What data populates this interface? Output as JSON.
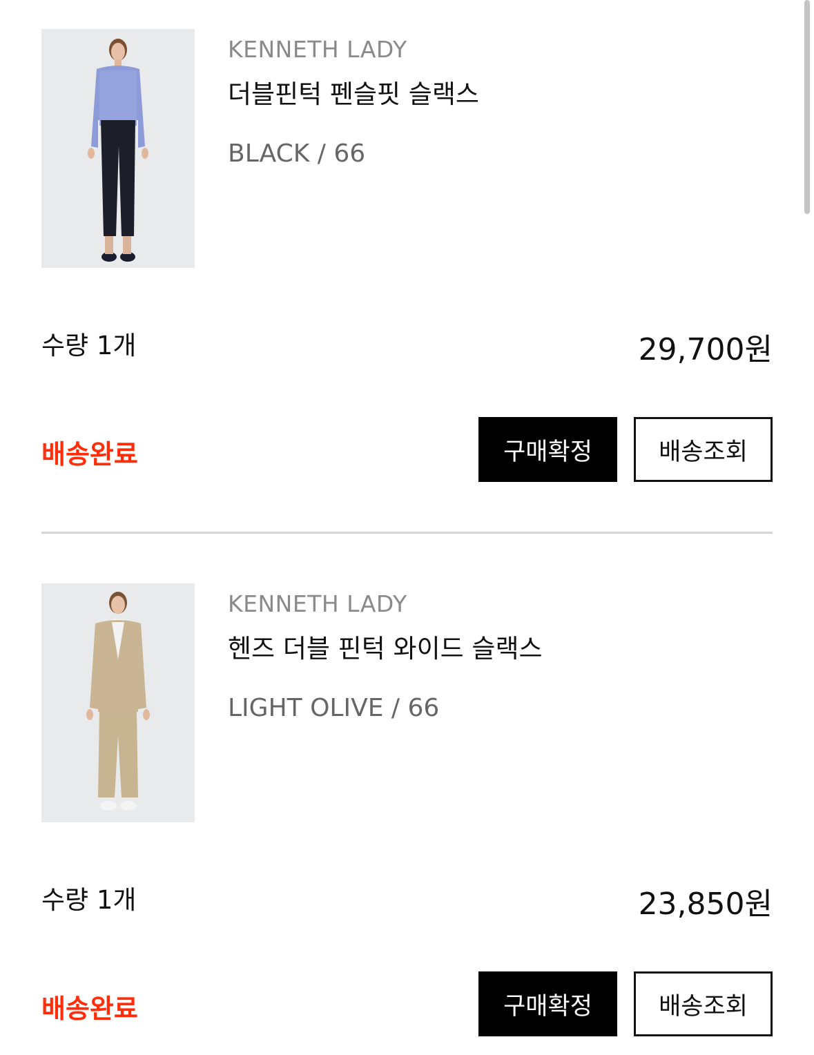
{
  "orders": [
    {
      "brand": "KENNETH LADY",
      "product_name": "더블핀턱 펜슬핏 슬랙스",
      "option": "BLACK / 66",
      "quantity": "수량 1개",
      "price": "29,700원",
      "status": "배송완료",
      "confirm_label": "구매확정",
      "track_label": "배송조회"
    },
    {
      "brand": "KENNETH LADY",
      "product_name": "헨즈 더블 핀턱 와이드 슬랙스",
      "option": "LIGHT OLIVE / 66",
      "quantity": "수량 1개",
      "price": "23,850원",
      "status": "배송완료",
      "confirm_label": "구매확정",
      "track_label": "배송조회"
    }
  ],
  "colors": {
    "status": "#ff2d0a",
    "confirm_button_bg": "#000000",
    "brand_text": "#8a8a8a"
  }
}
